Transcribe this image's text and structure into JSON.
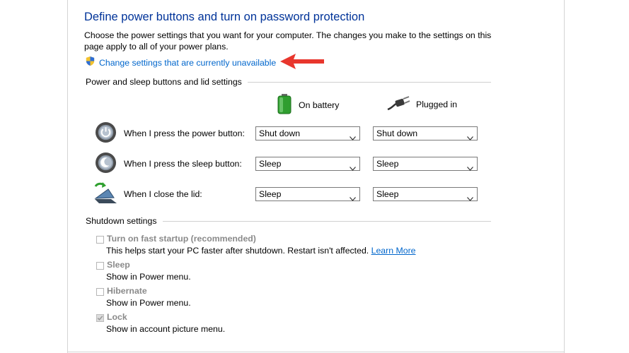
{
  "header": {
    "title": "Define power buttons and turn on password protection",
    "description": "Choose the power settings that you want for your computer. The changes you make to the settings on this page apply to all of your power plans.",
    "change_link": "Change settings that are currently unavailable"
  },
  "power_section": {
    "title": "Power and sleep buttons and lid settings",
    "columns": {
      "battery": "On battery",
      "plugged": "Plugged in"
    },
    "rows": [
      {
        "label": "When I press the power button:",
        "battery": "Shut down",
        "plugged": "Shut down",
        "icon": "power-button-icon"
      },
      {
        "label": "When I press the sleep button:",
        "battery": "Sleep",
        "plugged": "Sleep",
        "icon": "sleep-button-icon"
      },
      {
        "label": "When I close the lid:",
        "battery": "Sleep",
        "plugged": "Sleep",
        "icon": "laptop-lid-icon"
      }
    ]
  },
  "shutdown_section": {
    "title": "Shutdown settings",
    "items": [
      {
        "label": "Turn on fast startup (recommended)",
        "desc": "This helps start your PC faster after shutdown. Restart isn't affected.",
        "link": "Learn More",
        "checked": false
      },
      {
        "label": "Sleep",
        "desc": "Show in Power menu.",
        "checked": false
      },
      {
        "label": "Hibernate",
        "desc": "Show in Power menu.",
        "checked": false
      },
      {
        "label": "Lock",
        "desc": "Show in account picture menu.",
        "checked": true
      }
    ]
  },
  "colors": {
    "title": "#003399",
    "link": "#0066cc",
    "arrow": "#e8362d"
  }
}
